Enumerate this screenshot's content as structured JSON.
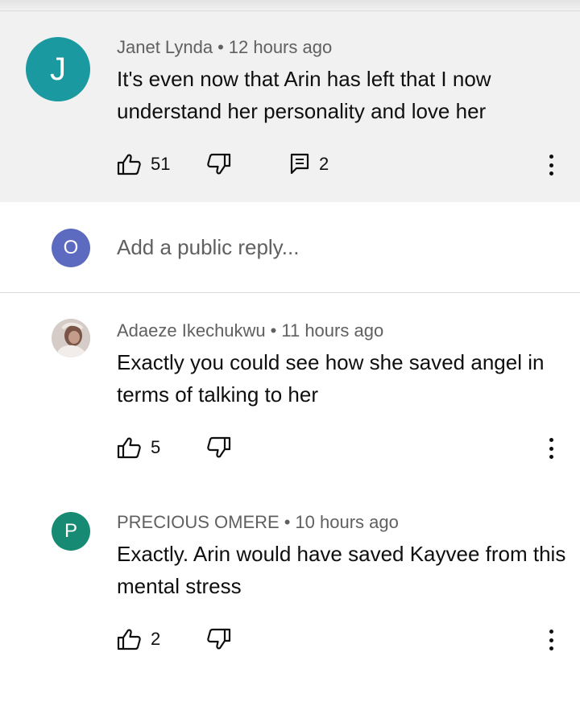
{
  "comments": [
    {
      "avatar_letter": "J",
      "avatar_color": "#1a9aa0",
      "author": "Janet Lynda",
      "separator": "•",
      "time": "12 hours ago",
      "text": "It's even now that Arin has left that I now understand her personality and love her",
      "likes": "51",
      "replies": "2"
    },
    {
      "avatar_letter": "",
      "avatar_color": "",
      "author": "Adaeze Ikechukwu",
      "separator": "•",
      "time": "11 hours ago",
      "text": "Exactly you could see how she saved angel in terms of talking to her",
      "likes": "5"
    },
    {
      "avatar_letter": "P",
      "avatar_color": "#178a73",
      "author": "PRECIOUS OMERE",
      "separator": "•",
      "time": "10 hours ago",
      "text": "Exactly. Arin would have saved Kayvee from this mental stress",
      "likes": "2"
    }
  ],
  "reply_box": {
    "avatar_letter": "O",
    "avatar_color": "#5c6bc0",
    "placeholder": "Add a public reply..."
  },
  "icons": {
    "like": "thumbs-up-icon",
    "dislike": "thumbs-down-icon",
    "reply": "comment-icon",
    "more": "more-vert-icon"
  }
}
